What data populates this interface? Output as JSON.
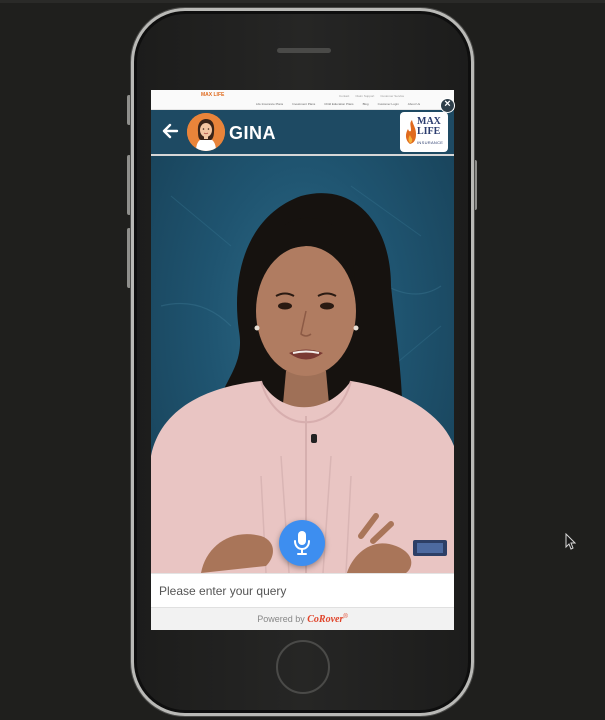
{
  "website_nav": {
    "logo_text": "MAX LIFE",
    "links": [
      "Life Insurance Plans",
      "Investment Plans",
      "Child Education Plans",
      "Blog",
      "Customer Login",
      "About Us"
    ],
    "top_links": [
      "Contact",
      "Claim Support",
      "Customer Service"
    ]
  },
  "chat": {
    "close_symbol": "×",
    "header": {
      "bot_name": "GINA",
      "brand_max": "MAX",
      "brand_life": "LIFE",
      "brand_insurance": "INSURANCE"
    },
    "query_placeholder": "Please enter your query",
    "footer": {
      "powered_by": "Powered by",
      "brand": "CoRover",
      "registered": "®"
    }
  },
  "colors": {
    "header_bg": "#1e4a63",
    "mic_button": "#3d8ef0",
    "brand_orange": "#e9843a",
    "corover_red": "#e0442a"
  },
  "icons": [
    "back-arrow-icon",
    "avatar-icon",
    "close-icon",
    "microphone-icon",
    "mouse-cursor-icon",
    "flame-icon"
  ]
}
